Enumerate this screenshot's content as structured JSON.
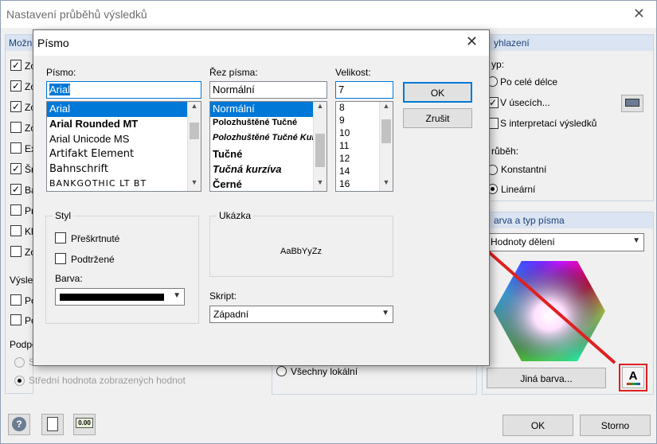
{
  "bg": {
    "title": "Nastavení průběhů výsledků",
    "left_group_title": "Možn",
    "left_checks": [
      {
        "label": "Zo",
        "checked": true
      },
      {
        "label": "Zo",
        "checked": true
      },
      {
        "label": "Zo",
        "checked": true
      },
      {
        "label": "Zo",
        "checked": false
      },
      {
        "label": "Ex",
        "checked": false
      },
      {
        "label": "Šr",
        "checked": true
      },
      {
        "label": "Ba",
        "checked": true
      },
      {
        "label": "Pr",
        "checked": false
      },
      {
        "label": "Kl",
        "checked": false
      },
      {
        "label": "Zo",
        "checked": false
      }
    ],
    "vysle_label": "Výsle",
    "vysle_checks": [
      {
        "label": "Po"
      },
      {
        "label": "Po"
      }
    ],
    "podp_label": "Podpo",
    "podp_radio_1": "S",
    "podp_radio_2": "Střední hodnota zobrazených hodnot",
    "middle_radio": "Všechny lokální",
    "right_top_title": "yhlazení",
    "typ_label": "yp:",
    "typ_options": [
      "Po celé délce",
      "V úsecích...",
      "S interpretací výsledků"
    ],
    "prubeh_label": "růběh:",
    "prubeh_options": [
      "Konstantní",
      "Lineární"
    ],
    "color_group_title": "arva a typ písma",
    "color_dropdown": "Hodnoty dělení",
    "other_color_button": "Jiná barva...",
    "ok_button": "OK",
    "storno_button": "Storno",
    "colors": {
      "accent": "#1e3f7a",
      "group_header": "#dae4f2",
      "arrow": "#e02020"
    }
  },
  "font_dialog": {
    "title": "Písmo",
    "font_label": "Písmo:",
    "font_value": "Arial",
    "font_list": [
      "Arial",
      "Arial Rounded MT",
      "Arial Unicode MS",
      "Artifakt Element",
      "Bahnschrift",
      "BANKGOTHIC LT BT"
    ],
    "style_label": "Řez písma:",
    "style_value": "Normální",
    "style_list": [
      "Normální",
      "Polozhuštěné Tučné",
      "Polozhuštěné Tučné Kurzíva",
      "Tučné",
      "Tučná kurzíva",
      "Černé"
    ],
    "size_label": "Velikost:",
    "size_value": "7",
    "size_list": [
      "8",
      "9",
      "10",
      "11",
      "12",
      "14",
      "16"
    ],
    "ok_button": "OK",
    "cancel_button": "Zrušit",
    "effects_legend": "Styl",
    "strikeout_label": "Přeškrtnuté",
    "underline_label": "Podtržené",
    "color_label": "Barva:",
    "color_value": "#000000",
    "sample_legend": "Ukázka",
    "sample_text": "AaBbYyZz",
    "script_label": "Skript:",
    "script_value": "Západní"
  }
}
